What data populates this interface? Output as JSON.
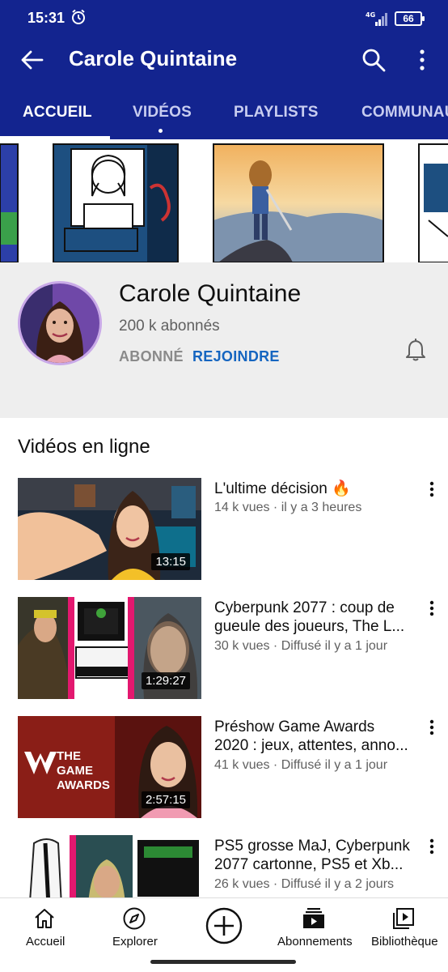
{
  "status_bar": {
    "time": "15:31",
    "network": "4G",
    "battery": "66",
    "icons": [
      "alarm-icon",
      "signal-icon",
      "battery-icon"
    ]
  },
  "app_bar": {
    "title": "Carole Quintaine",
    "icons": [
      "back-arrow-icon",
      "search-icon",
      "more-vertical-icon"
    ]
  },
  "tabs": [
    {
      "label": "ACCUEIL",
      "active": true
    },
    {
      "label": "VIDÉOS",
      "active": false
    },
    {
      "label": "PLAYLISTS",
      "active": false
    },
    {
      "label": "COMMUNAUTÉ",
      "active": false
    }
  ],
  "channel": {
    "name": "Carole Quintaine",
    "subscribers": "200 k abonnés",
    "subscribed_label": "ABONNÉ",
    "join_label": "REJOINDRE",
    "bell_icon": "bell-icon"
  },
  "section_title": "Vidéos en ligne",
  "videos": [
    {
      "title_lines": [
        "L'ultime décision 🔥"
      ],
      "meta": "14 k vues · il y a 3 heures",
      "duration": "13:15"
    },
    {
      "title_lines": [
        "Cyberpunk 2077 : coup de",
        "gueule des joueurs, The L..."
      ],
      "meta": "30 k vues · Diffusé il y a 1 jour",
      "duration": "1:29:27"
    },
    {
      "title_lines": [
        "Préshow Game Awards",
        "2020 : jeux, attentes, anno..."
      ],
      "meta": "41 k vues · Diffusé il y a 1 jour",
      "duration": "2:57:15",
      "thumb_text": [
        "THE",
        "GAME",
        "AWARDS"
      ]
    },
    {
      "title_lines": [
        "PS5 grosse MaJ, Cyberpunk",
        "2077 cartonne, PS5 et Xb..."
      ],
      "meta": "26 k vues · Diffusé il y a 2 jours",
      "duration": ""
    }
  ],
  "bottom_nav": [
    {
      "label": "Accueil",
      "icon": "home-icon"
    },
    {
      "label": "Explorer",
      "icon": "compass-icon"
    },
    {
      "label": "",
      "icon": "add-circle-icon"
    },
    {
      "label": "Abonnements",
      "icon": "subscriptions-icon"
    },
    {
      "label": "Bibliothèque",
      "icon": "library-icon"
    }
  ],
  "colors": {
    "app_bar": "#13248f",
    "join_blue": "#1565c0",
    "header_bg": "#eeeeee"
  }
}
